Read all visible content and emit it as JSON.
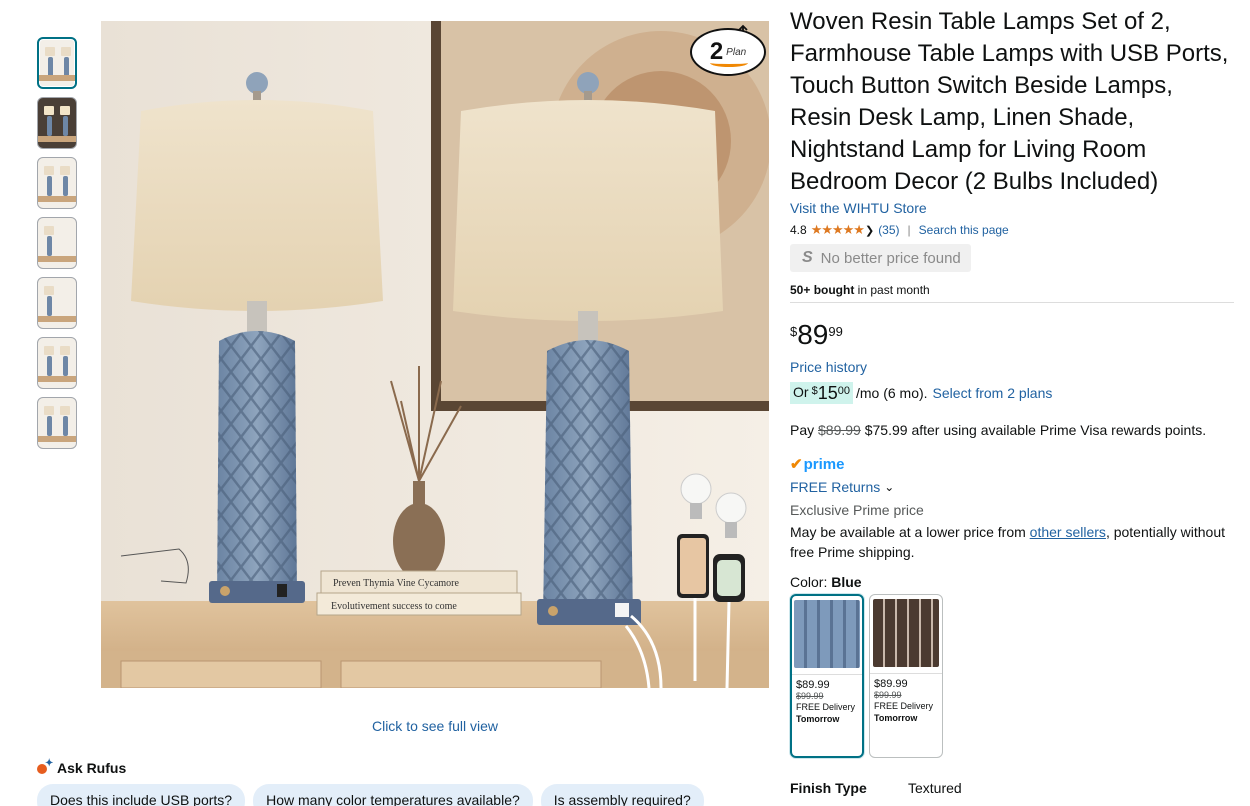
{
  "thumbnails": [
    {
      "name": "thumb-1",
      "active": true
    },
    {
      "name": "thumb-2",
      "dark": true
    },
    {
      "name": "thumb-3"
    },
    {
      "name": "thumb-4"
    },
    {
      "name": "thumb-5"
    },
    {
      "name": "thumb-6"
    },
    {
      "name": "thumb-7"
    }
  ],
  "gallery": {
    "click_full_view": "Click to see full view",
    "plan_badge_number": "2",
    "plan_badge_text": "Plan",
    "book_text_1": "Preven Thymia Vine Cycamore",
    "book_text_2": "Evolutivement success to come"
  },
  "rufus": {
    "label": "Ask Rufus",
    "chips": [
      "Does this include USB ports?",
      "How many color temperatures available?",
      "Is assembly required?"
    ]
  },
  "product": {
    "title": "Woven Resin Table Lamps Set of 2, Farmhouse Table Lamps with USB Ports, Touch Button Switch Beside Lamps, Resin Desk Lamp, Linen Shade, Nightstand Lamp for Living Room Bedroom Decor (2 Bulbs Included)",
    "store_link": "Visit the WIHTU Store",
    "rating": "4.8",
    "stars": "★★★★★",
    "review_count": "(35)",
    "search_page": "Search this page",
    "no_better_price": "No better price found",
    "bought_bold": "50+ bought",
    "bought_rest": " in past month",
    "price_symbol": "$",
    "price_whole": "89",
    "price_fraction": "99",
    "price_history": "Price history",
    "monthly_prefix": "Or ",
    "monthly_symbol": "$",
    "monthly_whole": "15",
    "monthly_fraction": "00",
    "monthly_rest": "/mo (6 mo).",
    "monthly_link": "Select from 2 plans",
    "pay_prefix": "Pay ",
    "pay_strike": "$89.99",
    "pay_rest": " $75.99 after using available Prime Visa rewards points.",
    "prime_label": "prime",
    "free_returns": "FREE Returns",
    "exclusive": "Exclusive Prime price",
    "maybe_prefix": "May be available at a lower price from ",
    "maybe_link": "other sellers",
    "maybe_suffix": ", potentially without free Prime shipping.",
    "color_label": "Color: ",
    "color_value": "Blue",
    "swatches": [
      {
        "price": "$89.99",
        "old_price": "$99.99",
        "delivery": "FREE Delivery",
        "when": "Tomorrow"
      },
      {
        "price": "$89.99",
        "old_price": "$99.99",
        "delivery": "FREE Delivery",
        "when": "Tomorrow"
      }
    ],
    "finish_key": "Finish Type",
    "finish_value": "Textured"
  },
  "colors": {
    "link": "#2162a1",
    "star": "#de7921",
    "prime": "#1a98ff",
    "teal_selected": "#007185"
  }
}
